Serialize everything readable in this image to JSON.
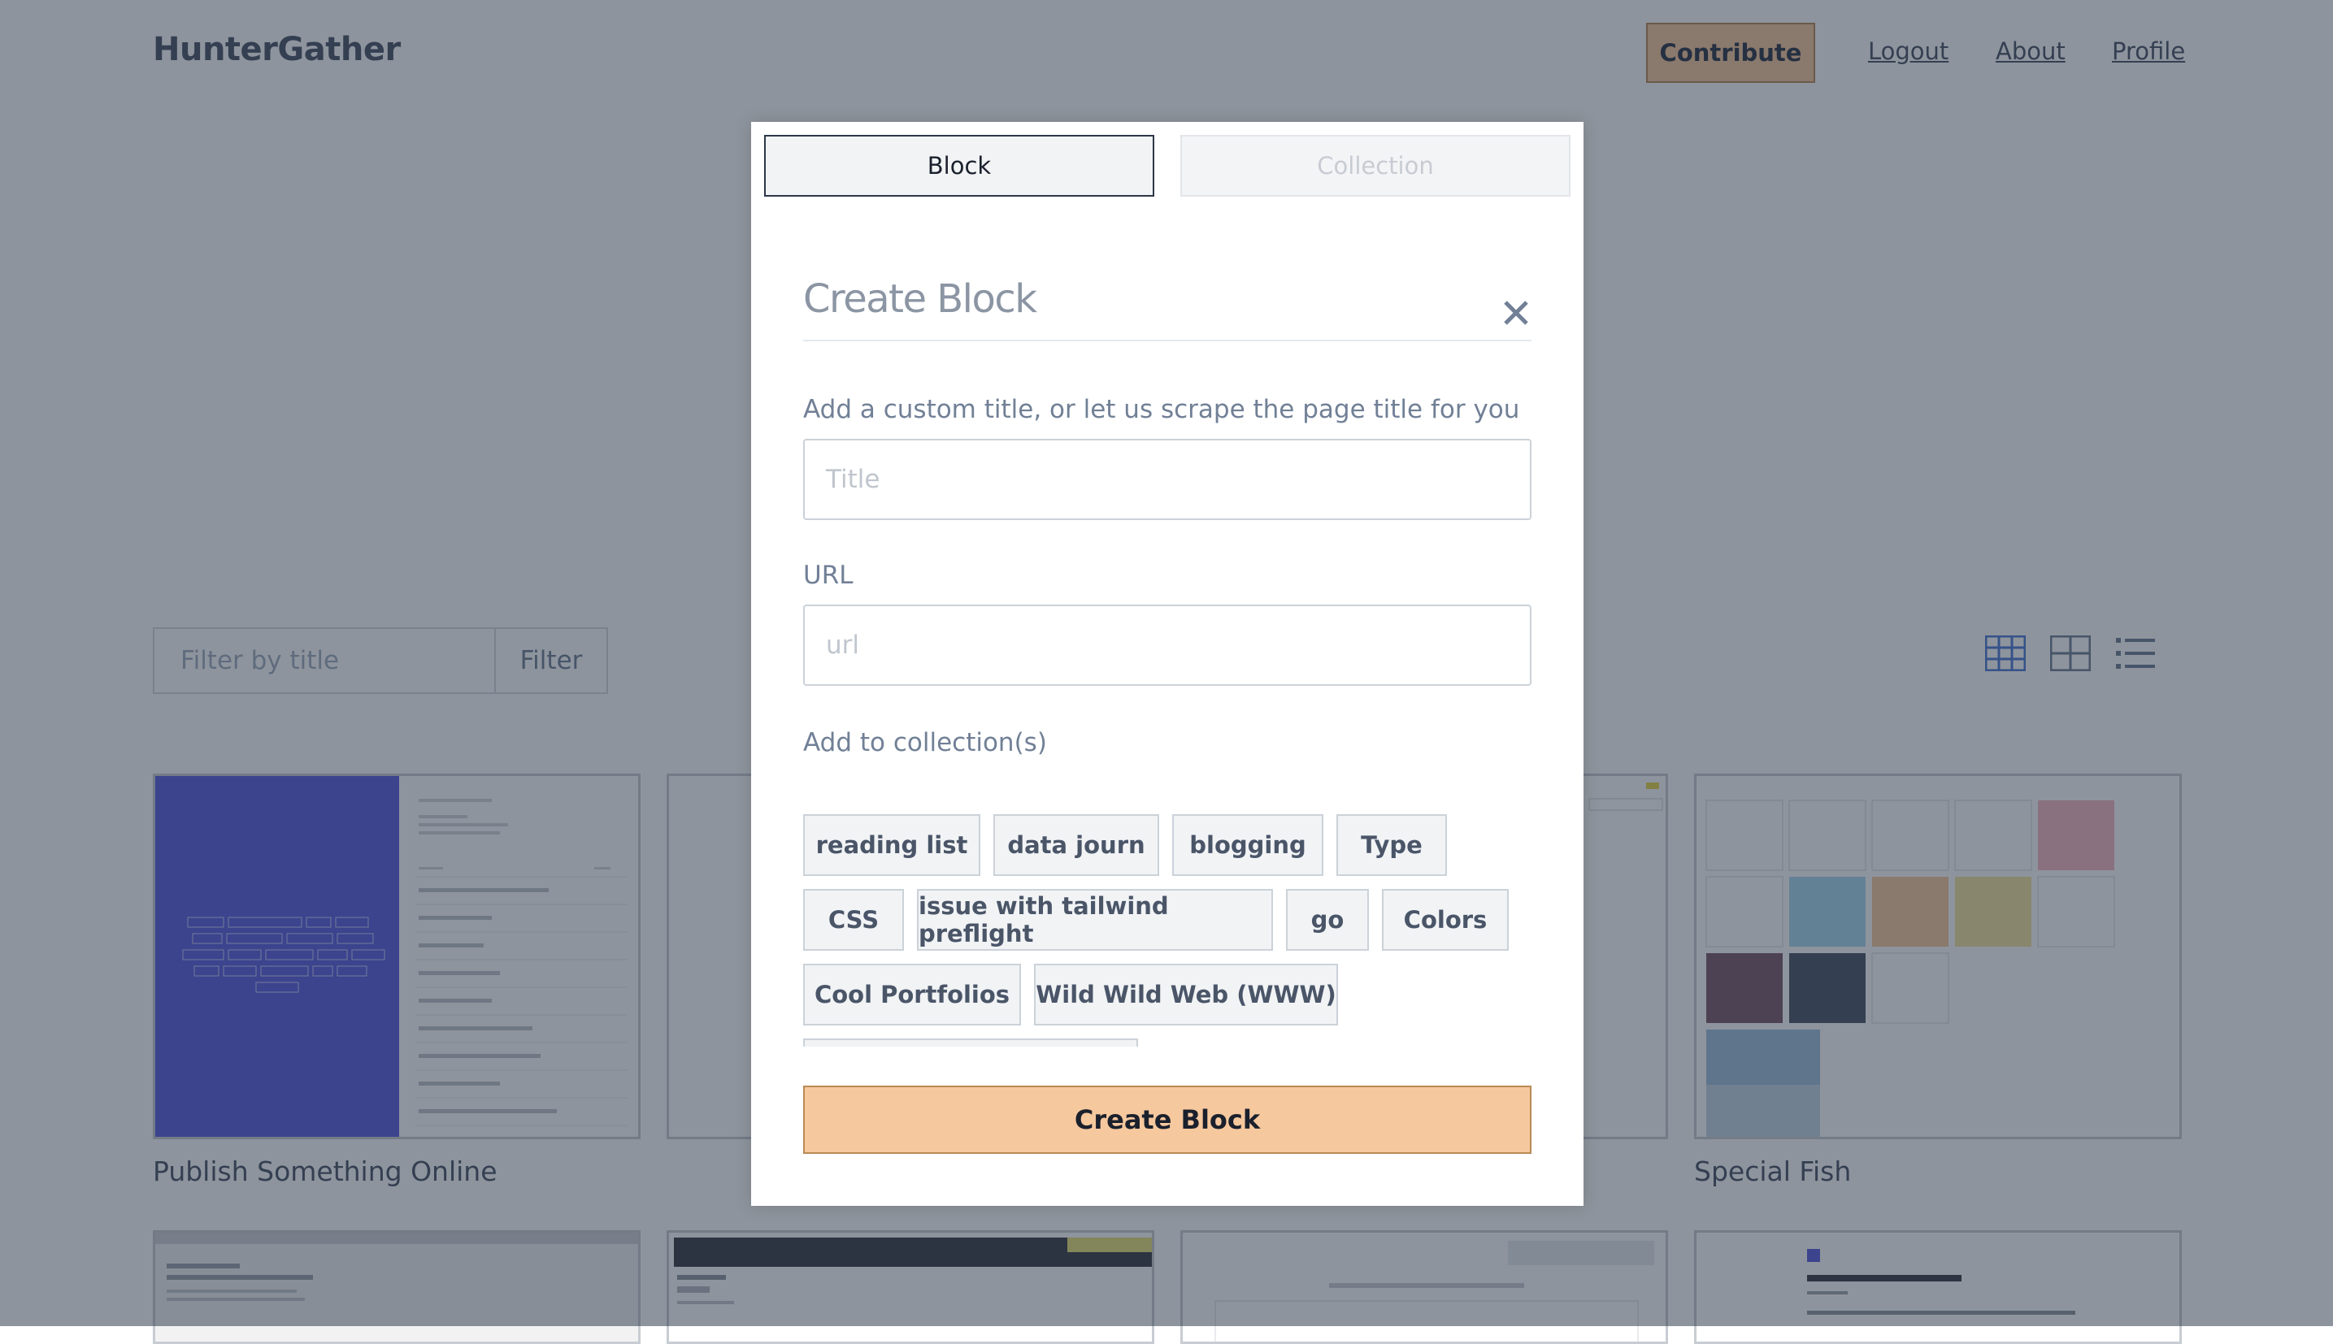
{
  "app": {
    "logo": "HunterGather",
    "nav": {
      "contribute": "Contribute",
      "logout": "Logout",
      "about": "About",
      "profile": "Profile"
    }
  },
  "filter": {
    "placeholder": "Filter by title",
    "button": "Filter"
  },
  "view_icons": [
    "grid-small-icon",
    "grid-large-icon",
    "list-icon"
  ],
  "cards": [
    {
      "title": "Publish Something Online"
    },
    {
      "title": "Special Fish"
    }
  ],
  "modal": {
    "tabs": {
      "block": "Block",
      "collection": "Collection"
    },
    "title": "Create Block",
    "title_hint": "Add a custom title, or let us scrape the page title for you",
    "title_placeholder": "Title",
    "url_label": "URL",
    "url_placeholder": "url",
    "collections_label": "Add to collection(s)",
    "collections": [
      "reading list",
      "data journ",
      "blogging",
      "Type",
      "CSS",
      "issue with tailwind preflight",
      "go",
      "Colors",
      "Cool Portfolios",
      "Wild Wild Web (WWW)"
    ],
    "submit": "Create Block"
  },
  "colors": {
    "accent": "#f6c89e",
    "accent_border": "#b98a55",
    "text": "#4a5568",
    "overlay": "rgba(30,41,59,0.5)"
  }
}
